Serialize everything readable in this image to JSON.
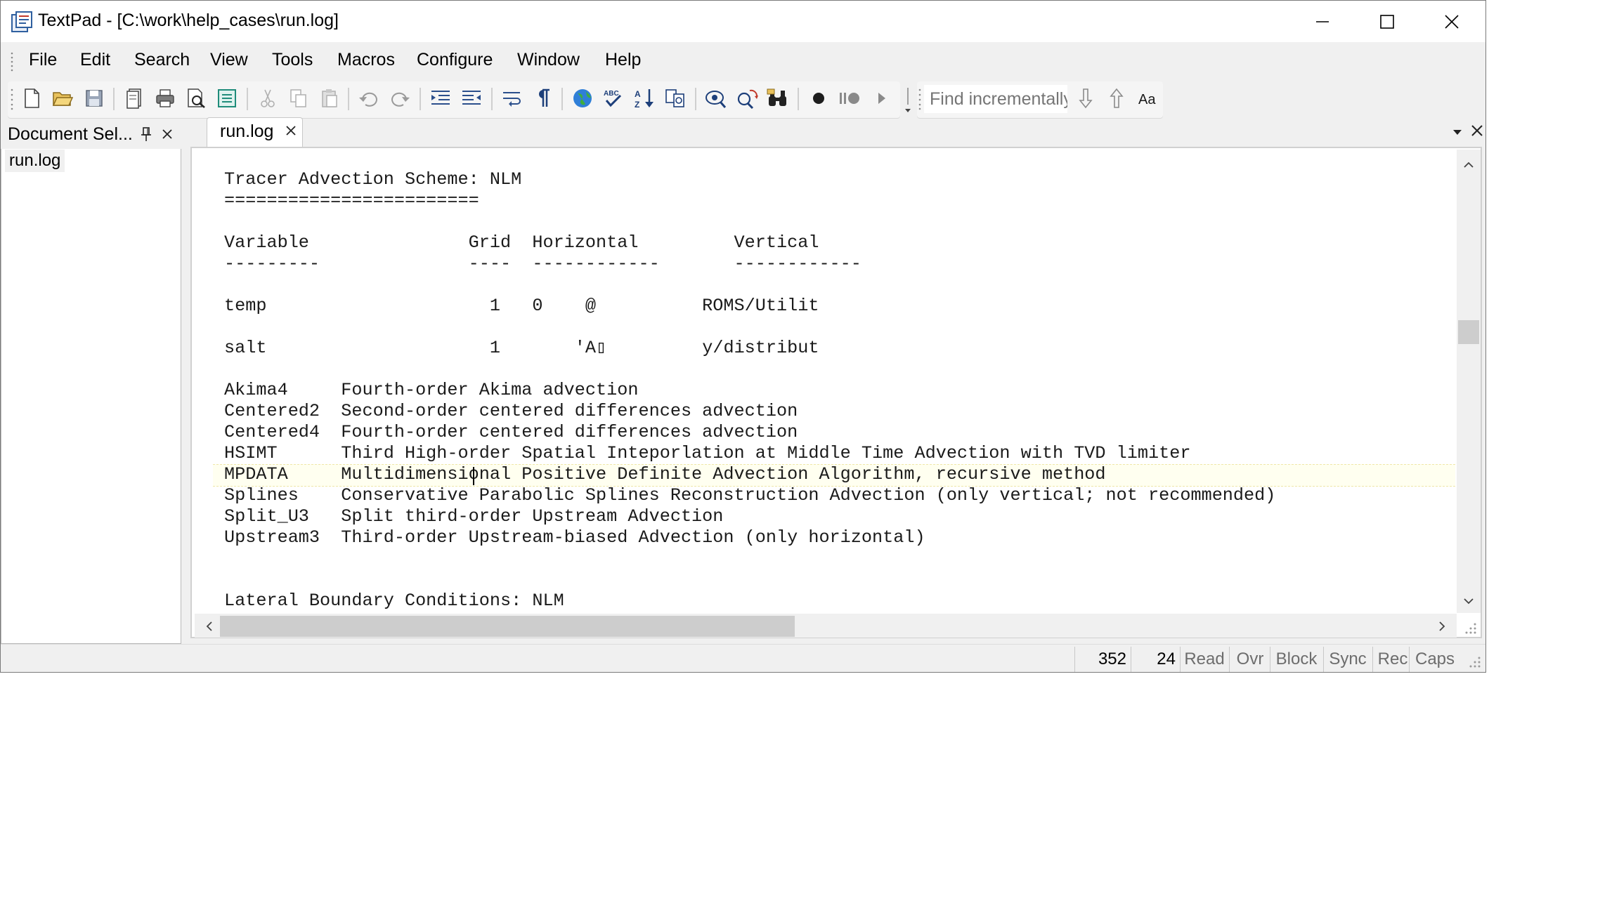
{
  "window": {
    "title": "TextPad - [C:\\work\\help_cases\\run.log]",
    "minimize_glyph": "—",
    "maximize_glyph": "☐",
    "close_glyph": "✕"
  },
  "menu": {
    "items": [
      "File",
      "Edit",
      "Search",
      "View",
      "Tools",
      "Macros",
      "Configure",
      "Window",
      "Help"
    ]
  },
  "toolbar": {
    "find_placeholder": "Find incrementally",
    "icons": [
      "new-file-icon",
      "open-file-icon",
      "save-icon",
      "save-all-icon",
      "print-icon",
      "print-preview-icon",
      "spell-panel-icon",
      "cut-icon",
      "copy-icon",
      "paste-icon",
      "undo-icon",
      "redo-icon",
      "indent-icon",
      "outdent-icon",
      "word-wrap-icon",
      "pilcrow-icon",
      "browser-icon",
      "spell-check-icon",
      "sort-icon",
      "compare-icon",
      "view-icon",
      "replace-icon",
      "find-in-files-icon",
      "record-macro-icon",
      "stop-macro-icon",
      "play-macro-icon",
      "find-next-down-icon",
      "find-previous-up-icon",
      "match-case-icon"
    ]
  },
  "doc_panel": {
    "title": "Document Sel...",
    "items": [
      "run.log"
    ]
  },
  "editor": {
    "tab_label": "run.log",
    "lines": [
      "Tracer Advection Scheme: NLM",
      "========================",
      "",
      "Variable               Grid  Horizontal         Vertical",
      "---------              ----  ------------       ------------",
      "",
      "temp                     1   0    @          ROMS/Utilit",
      "",
      "salt                     1       'A▯         y/distribut",
      "",
      "Akima4     Fourth-order Akima advection",
      "Centered2  Second-order centered differences advection",
      "Centered4  Fourth-order centered differences advection",
      "HSIMT      Third High-order Spatial Inteporlation at Middle Time Advection with TVD limiter",
      "MPDATA     Multidimensional Positive Definite Advection Algorithm, recursive method",
      "Splines    Conservative Parabolic Splines Reconstruction Advection (only vertical; not recommended)",
      "Split_U3   Split third-order Upstream Advection",
      "Upstream3  Third-order Upstream-biased Advection (only horizontal)",
      "",
      "",
      "Lateral Boundary Conditions: NLM"
    ],
    "current_line_index": 14
  },
  "status": {
    "line": "352",
    "column": "24",
    "flags": [
      "Read",
      "Ovr",
      "Block",
      "Sync",
      "Rec",
      "Caps"
    ]
  },
  "colors": {
    "accent": "#3c7fd8",
    "current_line": "#fffff0",
    "window_bg": "#f0f0f0"
  }
}
